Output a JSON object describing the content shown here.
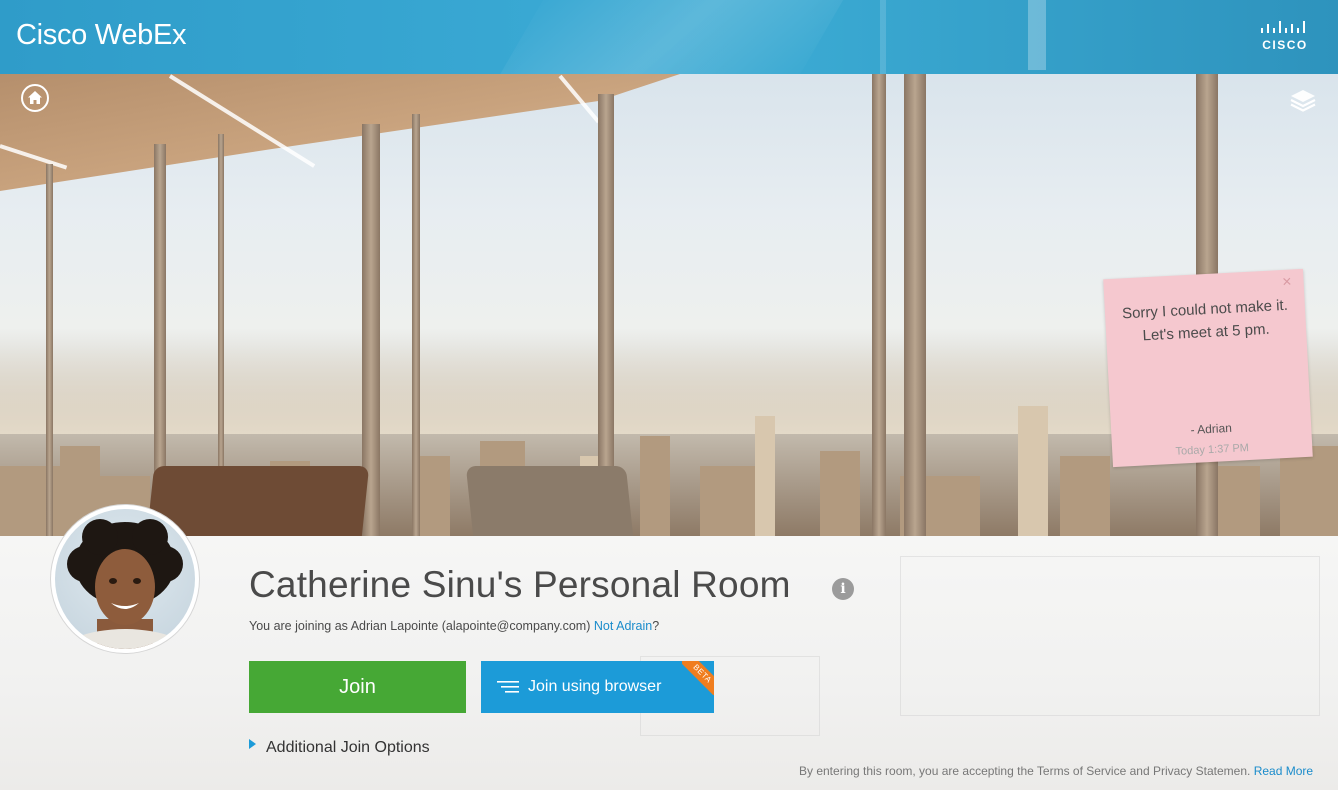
{
  "header": {
    "app_title": "Cisco WebEx",
    "brand_logo_text": "CISCO"
  },
  "colors": {
    "header_blue": "#39a8d3",
    "join_green": "#46a835",
    "browser_blue": "#1c9bd8",
    "beta_orange": "#f07d1e",
    "link_blue": "#1b8ccb",
    "note_pink": "#f5c8cf"
  },
  "icons": {
    "home": "home-icon",
    "layers": "layers-icon",
    "info": "info-icon",
    "browser_lines": "browser-lines-icon",
    "expand": "triangle-right-icon"
  },
  "sticky_note": {
    "message": "Sorry I could not make it. Let's meet at 5 pm.",
    "signature": "- Adrian",
    "time": "Today 1:37 PM",
    "close_glyph": "×"
  },
  "room": {
    "title": "Catherine Sinu's Personal Room",
    "info_glyph": "i",
    "joining_prefix": "You are joining as Adrian Lapointe (alapointe@company.com)",
    "not_user_link": "Not Adrain",
    "joining_suffix": "?"
  },
  "actions": {
    "join_label": "Join",
    "browser_label": "Join using browser",
    "beta_badge": "BETA",
    "additional_options": "Additional Join Options"
  },
  "footer": {
    "terms_text": "By entering this room, you are accepting the Terms of Service and Privacy Statemen.",
    "read_more": "Read More"
  }
}
